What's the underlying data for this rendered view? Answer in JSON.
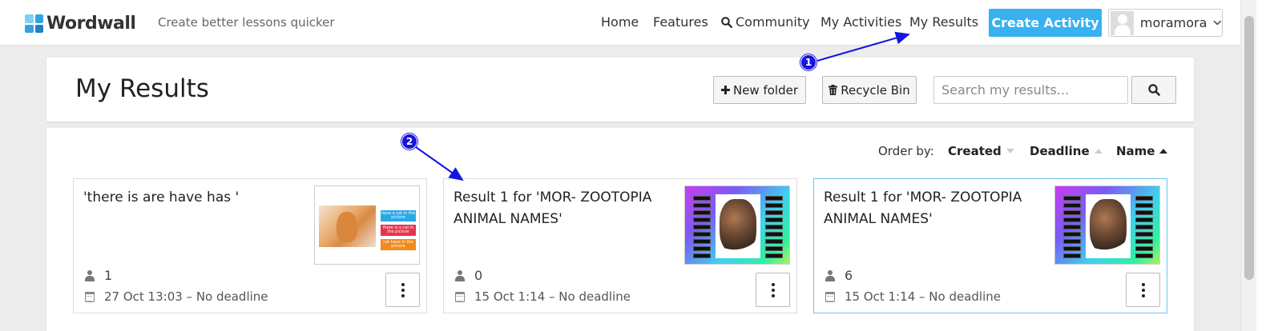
{
  "header": {
    "logo_text": "Wordwall",
    "tagline": "Create better lessons quicker",
    "nav": {
      "home": "Home",
      "features": "Features",
      "community": "Community",
      "my_activities": "My Activities",
      "my_results": "My Results"
    },
    "create_activity": "Create Activity",
    "user_name": "moramora"
  },
  "page": {
    "title": "My Results",
    "new_folder": "New folder",
    "recycle_bin": "Recycle Bin",
    "search_placeholder": "Search my results..."
  },
  "order": {
    "label": "Order by:",
    "created": "Created",
    "deadline": "Deadline",
    "name": "Name",
    "active_sort": "Name ascending"
  },
  "results": [
    {
      "title": "'there is are have has '",
      "users": "1",
      "date": "27 Oct 13:03 – No deadline",
      "thumb_tags": [
        "have a cat in the picture",
        "there is a cat in the picture",
        "cat have in the picture"
      ]
    },
    {
      "title": "Result 1 for 'MOR- ZOOTOPIA ANIMAL NAMES'",
      "users": "0",
      "date": "15 Oct 1:14 – No deadline"
    },
    {
      "title": "Result 1 for 'MOR- ZOOTOPIA ANIMAL NAMES'",
      "users": "6",
      "date": "15 Oct 1:14 – No deadline"
    }
  ],
  "annotations": {
    "badge_1": "1",
    "badge_2": "2",
    "color": "#1515e0"
  },
  "colors": {
    "accent": "#37b1f0",
    "background": "#ececec"
  }
}
